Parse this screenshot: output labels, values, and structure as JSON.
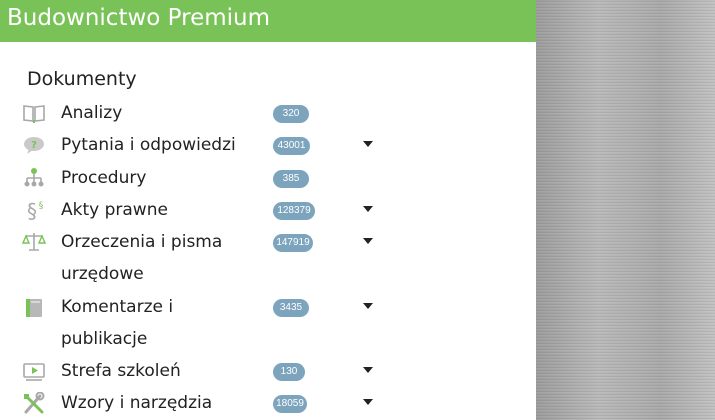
{
  "header": {
    "title": "Budownictwo Premium"
  },
  "section": {
    "title": "Dokumenty"
  },
  "menu": [
    {
      "label": "Analizy",
      "count": "320",
      "icon": "book-icon",
      "has_dropdown": false
    },
    {
      "label": "Pytania i odpowiedzi",
      "count": "43001",
      "icon": "question-bubble-icon",
      "has_dropdown": true
    },
    {
      "label": "Procedury",
      "count": "385",
      "icon": "hierarchy-icon",
      "has_dropdown": false
    },
    {
      "label": "Akty prawne",
      "count": "128379",
      "icon": "paragraph-icon",
      "has_dropdown": true
    },
    {
      "label_line1": "Orzeczenia i pisma",
      "label_line2": "urzędowe",
      "count": "147919",
      "icon": "scales-icon",
      "has_dropdown": true
    },
    {
      "label_line1": "Komentarze i",
      "label_line2": "publikacje",
      "count": "3435",
      "icon": "book-green-icon",
      "has_dropdown": true
    },
    {
      "label": "Strefa szkoleń",
      "count": "130",
      "icon": "video-play-icon",
      "has_dropdown": true
    },
    {
      "label": "Wzory i narzędzia",
      "count": "18059",
      "icon": "tools-icon",
      "has_dropdown": true
    }
  ],
  "colors": {
    "header_green": "#79c257",
    "badge_blue": "#7da4bd",
    "icon_gray": "#a8a8a8",
    "icon_green": "#79c257"
  }
}
